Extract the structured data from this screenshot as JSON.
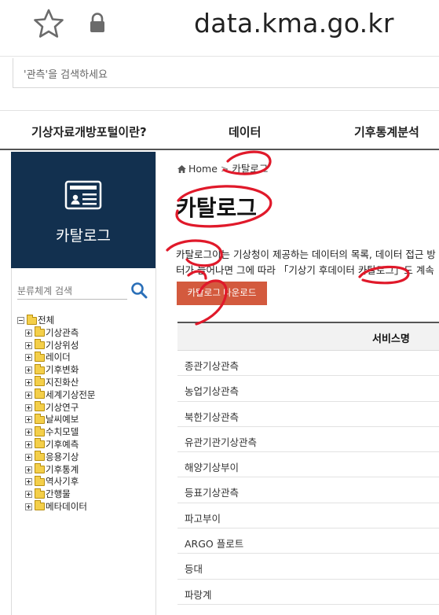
{
  "browser": {
    "url": "data.kma.go.kr",
    "favorite_icon": "star-outline-icon",
    "secure_icon": "lock-icon"
  },
  "site_search": {
    "placeholder": "'관측'을 검색하세요"
  },
  "gnb": {
    "items": [
      "기상자료개방포털이란?",
      "데이터",
      "기후통계분석"
    ]
  },
  "lnb": {
    "title": "카탈로그",
    "icon": "catalog-card-icon",
    "tree_search_placeholder": "분류체계 검색",
    "tree_search_icon": "search-icon",
    "tree": {
      "root": "전체",
      "children": [
        "기상관측",
        "기상위성",
        "레이더",
        "기후변화",
        "지진화산",
        "세계기상전문",
        "기상연구",
        "날씨예보",
        "수치모델",
        "기후예측",
        "응용기상",
        "기후통계",
        "역사기후",
        "간행물",
        "메타데이터"
      ]
    }
  },
  "content": {
    "breadcrumb": {
      "home": "Home",
      "current": "카탈로그"
    },
    "title": "카탈로그",
    "description_line1": "카탈로그이는 기상청이 제공하는 데이터의 목록, 데이터 접근 방",
    "description_line2": "터가 늘어나면 그에 따라 「기상기 후데이터 카탈로그」도 계속",
    "download_button": "카탈로그 다운로드",
    "table": {
      "header": "서비스명",
      "rows": [
        "종관기상관측",
        "농업기상관측",
        "북한기상관측",
        "유관기관기상관측",
        "해양기상부이",
        "등표기상관측",
        "파고부이",
        "ARGO 플로트",
        "등대",
        "파랑계"
      ]
    }
  },
  "colors": {
    "lnb_bg": "#12304f",
    "download_button": "#d35a3e",
    "annotation_marker": "#e0192a"
  }
}
